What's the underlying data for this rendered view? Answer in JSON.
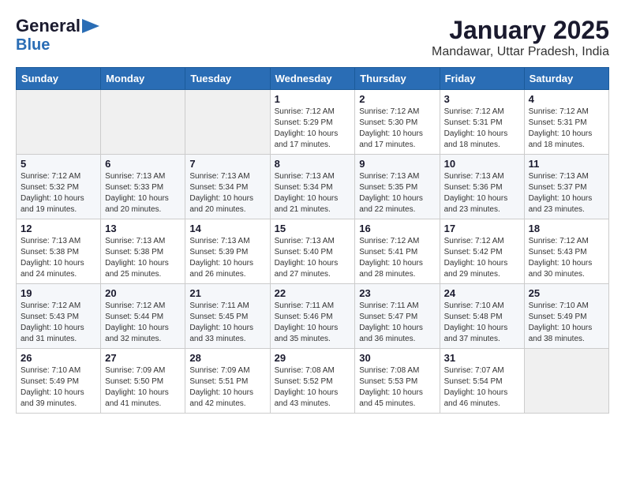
{
  "header": {
    "logo_general": "General",
    "logo_blue": "Blue",
    "month": "January 2025",
    "location": "Mandawar, Uttar Pradesh, India"
  },
  "weekdays": [
    "Sunday",
    "Monday",
    "Tuesday",
    "Wednesday",
    "Thursday",
    "Friday",
    "Saturday"
  ],
  "weeks": [
    [
      {
        "day": "",
        "info": ""
      },
      {
        "day": "",
        "info": ""
      },
      {
        "day": "",
        "info": ""
      },
      {
        "day": "1",
        "info": "Sunrise: 7:12 AM\nSunset: 5:29 PM\nDaylight: 10 hours\nand 17 minutes."
      },
      {
        "day": "2",
        "info": "Sunrise: 7:12 AM\nSunset: 5:30 PM\nDaylight: 10 hours\nand 17 minutes."
      },
      {
        "day": "3",
        "info": "Sunrise: 7:12 AM\nSunset: 5:31 PM\nDaylight: 10 hours\nand 18 minutes."
      },
      {
        "day": "4",
        "info": "Sunrise: 7:12 AM\nSunset: 5:31 PM\nDaylight: 10 hours\nand 18 minutes."
      }
    ],
    [
      {
        "day": "5",
        "info": "Sunrise: 7:12 AM\nSunset: 5:32 PM\nDaylight: 10 hours\nand 19 minutes."
      },
      {
        "day": "6",
        "info": "Sunrise: 7:13 AM\nSunset: 5:33 PM\nDaylight: 10 hours\nand 20 minutes."
      },
      {
        "day": "7",
        "info": "Sunrise: 7:13 AM\nSunset: 5:34 PM\nDaylight: 10 hours\nand 20 minutes."
      },
      {
        "day": "8",
        "info": "Sunrise: 7:13 AM\nSunset: 5:34 PM\nDaylight: 10 hours\nand 21 minutes."
      },
      {
        "day": "9",
        "info": "Sunrise: 7:13 AM\nSunset: 5:35 PM\nDaylight: 10 hours\nand 22 minutes."
      },
      {
        "day": "10",
        "info": "Sunrise: 7:13 AM\nSunset: 5:36 PM\nDaylight: 10 hours\nand 23 minutes."
      },
      {
        "day": "11",
        "info": "Sunrise: 7:13 AM\nSunset: 5:37 PM\nDaylight: 10 hours\nand 23 minutes."
      }
    ],
    [
      {
        "day": "12",
        "info": "Sunrise: 7:13 AM\nSunset: 5:38 PM\nDaylight: 10 hours\nand 24 minutes."
      },
      {
        "day": "13",
        "info": "Sunrise: 7:13 AM\nSunset: 5:38 PM\nDaylight: 10 hours\nand 25 minutes."
      },
      {
        "day": "14",
        "info": "Sunrise: 7:13 AM\nSunset: 5:39 PM\nDaylight: 10 hours\nand 26 minutes."
      },
      {
        "day": "15",
        "info": "Sunrise: 7:13 AM\nSunset: 5:40 PM\nDaylight: 10 hours\nand 27 minutes."
      },
      {
        "day": "16",
        "info": "Sunrise: 7:12 AM\nSunset: 5:41 PM\nDaylight: 10 hours\nand 28 minutes."
      },
      {
        "day": "17",
        "info": "Sunrise: 7:12 AM\nSunset: 5:42 PM\nDaylight: 10 hours\nand 29 minutes."
      },
      {
        "day": "18",
        "info": "Sunrise: 7:12 AM\nSunset: 5:43 PM\nDaylight: 10 hours\nand 30 minutes."
      }
    ],
    [
      {
        "day": "19",
        "info": "Sunrise: 7:12 AM\nSunset: 5:43 PM\nDaylight: 10 hours\nand 31 minutes."
      },
      {
        "day": "20",
        "info": "Sunrise: 7:12 AM\nSunset: 5:44 PM\nDaylight: 10 hours\nand 32 minutes."
      },
      {
        "day": "21",
        "info": "Sunrise: 7:11 AM\nSunset: 5:45 PM\nDaylight: 10 hours\nand 33 minutes."
      },
      {
        "day": "22",
        "info": "Sunrise: 7:11 AM\nSunset: 5:46 PM\nDaylight: 10 hours\nand 35 minutes."
      },
      {
        "day": "23",
        "info": "Sunrise: 7:11 AM\nSunset: 5:47 PM\nDaylight: 10 hours\nand 36 minutes."
      },
      {
        "day": "24",
        "info": "Sunrise: 7:10 AM\nSunset: 5:48 PM\nDaylight: 10 hours\nand 37 minutes."
      },
      {
        "day": "25",
        "info": "Sunrise: 7:10 AM\nSunset: 5:49 PM\nDaylight: 10 hours\nand 38 minutes."
      }
    ],
    [
      {
        "day": "26",
        "info": "Sunrise: 7:10 AM\nSunset: 5:49 PM\nDaylight: 10 hours\nand 39 minutes."
      },
      {
        "day": "27",
        "info": "Sunrise: 7:09 AM\nSunset: 5:50 PM\nDaylight: 10 hours\nand 41 minutes."
      },
      {
        "day": "28",
        "info": "Sunrise: 7:09 AM\nSunset: 5:51 PM\nDaylight: 10 hours\nand 42 minutes."
      },
      {
        "day": "29",
        "info": "Sunrise: 7:08 AM\nSunset: 5:52 PM\nDaylight: 10 hours\nand 43 minutes."
      },
      {
        "day": "30",
        "info": "Sunrise: 7:08 AM\nSunset: 5:53 PM\nDaylight: 10 hours\nand 45 minutes."
      },
      {
        "day": "31",
        "info": "Sunrise: 7:07 AM\nSunset: 5:54 PM\nDaylight: 10 hours\nand 46 minutes."
      },
      {
        "day": "",
        "info": ""
      }
    ]
  ]
}
